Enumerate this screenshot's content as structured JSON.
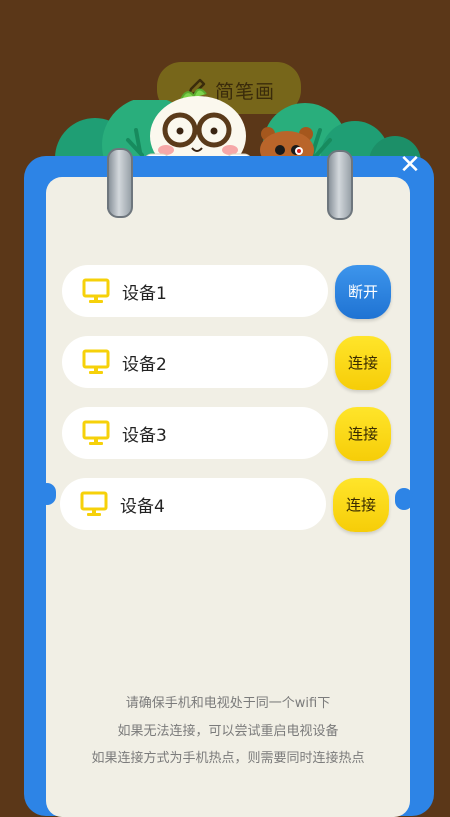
{
  "top_tab": {
    "label": "简笔画",
    "icon": "pencil-icon"
  },
  "close": {
    "label": "✕",
    "icon": "close-icon"
  },
  "devices": [
    {
      "name": "设备1",
      "action": "断开",
      "state": "connected",
      "icon": "monitor-icon"
    },
    {
      "name": "设备2",
      "action": "连接",
      "state": "disconnected",
      "icon": "monitor-icon"
    },
    {
      "name": "设备3",
      "action": "连接",
      "state": "disconnected",
      "icon": "monitor-icon"
    },
    {
      "name": "设备4",
      "action": "连接",
      "state": "disconnected",
      "icon": "monitor-icon"
    }
  ],
  "hints": [
    "请确保手机和电视处于同一个wifi下",
    "如果无法连接，可以尝试重启电视设备",
    "如果连接方式为手机热点，则需要同时连接热点"
  ],
  "colors": {
    "background": "#5b3718",
    "frame": "#2d84e6",
    "card": "#f1efe5",
    "disconnect_button": "#2d84e6",
    "connect_button": "#f9d50f",
    "device_icon": "#f6d10a"
  }
}
